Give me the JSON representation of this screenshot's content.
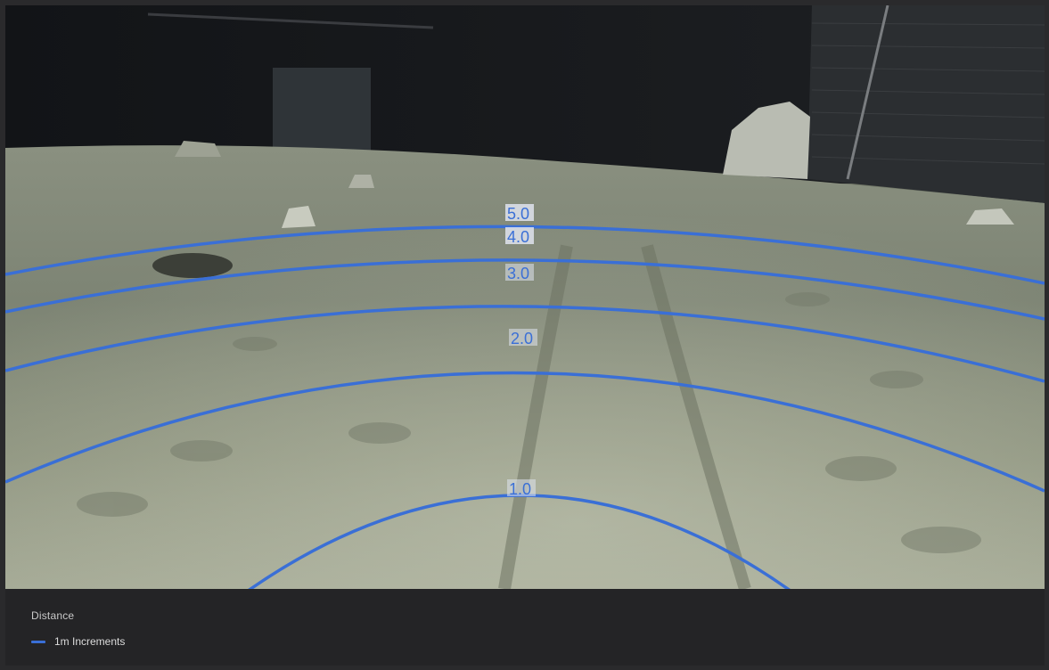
{
  "camera": {
    "scene": "lunar surface test area",
    "overlay_color": "#3a6fd6",
    "distance_rings": [
      {
        "label": "5.0"
      },
      {
        "label": "4.0"
      },
      {
        "label": "3.0"
      },
      {
        "label": "2.0"
      },
      {
        "label": "1.0"
      }
    ]
  },
  "legend": {
    "title": "Distance",
    "items": [
      {
        "label": "1m Increments",
        "color": "#3a6fd6"
      }
    ]
  }
}
